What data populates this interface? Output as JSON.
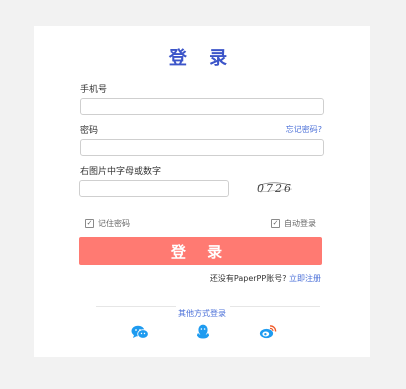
{
  "form": {
    "title": "登 录",
    "phone_label": "手机号",
    "phone_value": "",
    "password_label": "密码",
    "password_value": "",
    "forgot_link": "忘记密码?",
    "captcha_label": "右图片中字母或数字",
    "captcha_value": "",
    "captcha_text": "0726",
    "remember_label": "记住密码",
    "auto_login_label": "自动登录",
    "submit_label": "登 录",
    "no_account_text": "还没有PaperPP账号?",
    "register_link": "立即注册",
    "other_methods_label": "其他方式登录"
  },
  "social": [
    {
      "name": "wechat-icon"
    },
    {
      "name": "qq-icon"
    },
    {
      "name": "weibo-icon"
    }
  ],
  "colors": {
    "accent": "#3c55c9",
    "link": "#4a6fd8",
    "submit": "#ff7a72",
    "background": "#f2f2f2",
    "weibo": "#f05a28"
  }
}
